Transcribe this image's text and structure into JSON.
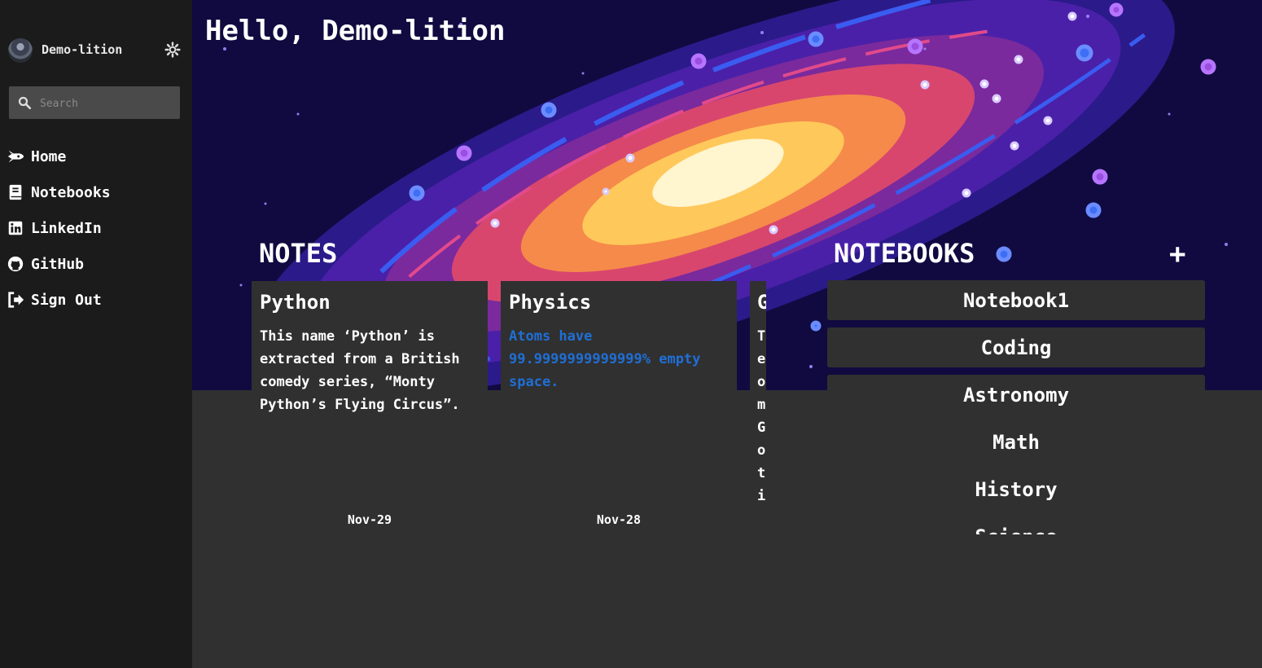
{
  "user": {
    "name": "Demo-lition"
  },
  "search": {
    "placeholder": "Search"
  },
  "nav": [
    {
      "label": "Home",
      "icon": "rocket-icon"
    },
    {
      "label": "Notebooks",
      "icon": "book-icon"
    },
    {
      "label": "LinkedIn",
      "icon": "linkedin-icon"
    },
    {
      "label": "GitHub",
      "icon": "github-icon"
    },
    {
      "label": "Sign Out",
      "icon": "sign-out-icon"
    }
  ],
  "greeting": "Hello, Demo-lition",
  "notes_section": {
    "title": "NOTES"
  },
  "notes": [
    {
      "title": "Python",
      "body": "This name ‘Python’ is extracted from a British comedy series, “Monty Python’s Flying Circus”.",
      "date": "Nov-29"
    },
    {
      "title": "Physics",
      "body": "Atoms have 99.9999999999999% empty space.",
      "date": "Nov-28"
    },
    {
      "title": "G",
      "body": "T e o m G o t i",
      "date": ""
    }
  ],
  "notebooks_section": {
    "title": "NOTEBOOKS",
    "add_label": "+"
  },
  "notebooks": [
    "Notebook1",
    "Coding",
    "Astronomy",
    "Math",
    "History",
    "Science"
  ],
  "colors": {
    "sidebar": "#1b1b1b",
    "main": "#303030",
    "link": "#1f6fd6",
    "hero_bg": "#110a40"
  }
}
